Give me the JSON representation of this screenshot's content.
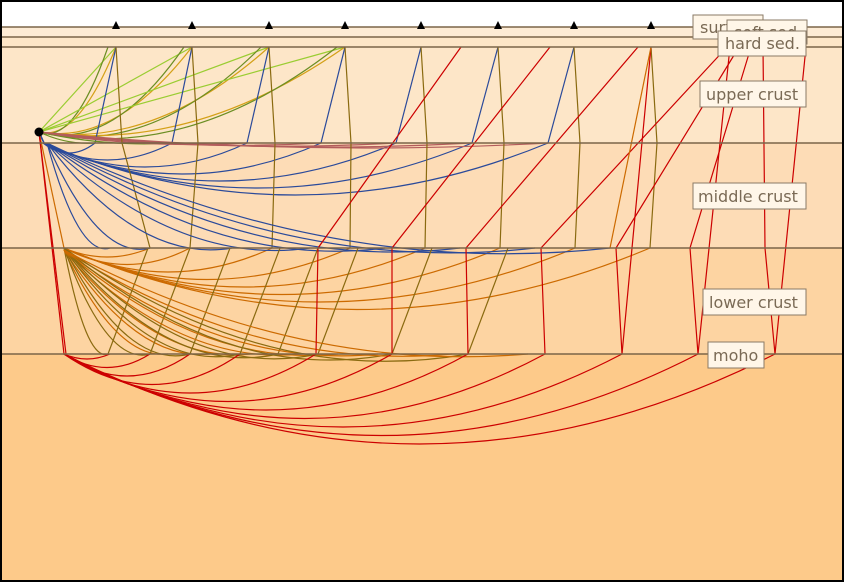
{
  "diagram": {
    "layers": [
      {
        "key": "surface",
        "name": "surface",
        "color": "#fdebd4"
      },
      {
        "key": "soft_sed",
        "name": "soft sed.",
        "color": "#fdebd4"
      },
      {
        "key": "hard_sed",
        "name": "hard sed.",
        "color": "#fde6c7"
      },
      {
        "key": "upper_crust",
        "name": "upper crust",
        "color": "#fde6c8"
      },
      {
        "key": "middle_crust",
        "name": "middle crust",
        "color": "#fddcb6"
      },
      {
        "key": "lower_crust",
        "name": "lower crust",
        "color": "#fdd4a2"
      },
      {
        "key": "moho",
        "name": "moho",
        "color": "#fdca8a"
      }
    ],
    "boundary_color": "#7b6548",
    "ray_colors": {
      "direct": "#9acd32",
      "soft_sed": "#d4a017",
      "hard_sed": "#6b8e23",
      "upper_crust": "#2b4a9a",
      "middle_crust": "#cc6a00",
      "lower_crust": "#8a6a10",
      "moho": "#cc0000"
    },
    "receiver_count": 8,
    "source": "source-point"
  }
}
